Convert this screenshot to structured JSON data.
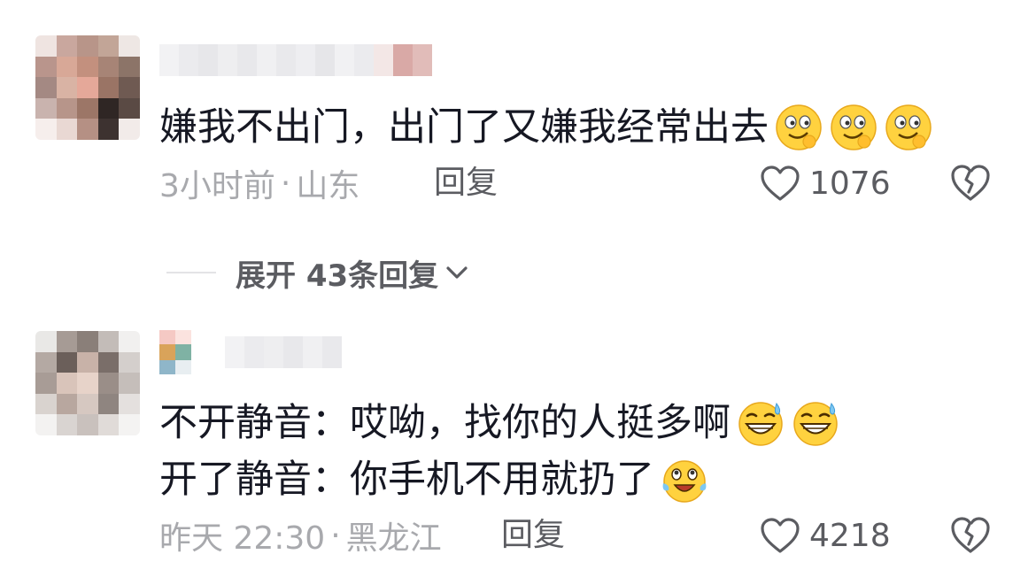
{
  "comments": [
    {
      "avatar_icon": "blurred-avatar",
      "username": "",
      "lines": [
        "嫌我不出门，出门了又嫌我经常出去"
      ],
      "emojis": [
        "smirk-emoji",
        "smirk-emoji",
        "smirk-emoji"
      ],
      "time": "3小时前",
      "separator": "·",
      "location": "山东",
      "reply_label": "回复",
      "like_icon": "heart-outline-icon",
      "like_count": "1076",
      "dislike_icon": "broken-heart-icon"
    },
    {
      "avatar_icon": "blurred-avatar",
      "username": "",
      "lines": [
        "不开静音：哎呦，找你的人挺多啊",
        "开了静音：你手机不用就扔了"
      ],
      "line1_emojis": [
        "sweat-grin-emoji",
        "sweat-grin-emoji"
      ],
      "line2_emojis": [
        "tears-of-joy-emoji"
      ],
      "time": "昨天 22:30",
      "separator": "·",
      "location": "黑龙江",
      "reply_label": "回复",
      "like_icon": "heart-outline-icon",
      "like_count": "4218",
      "dislike_icon": "broken-heart-icon"
    }
  ],
  "expand_replies": {
    "label": "展开 43条回复",
    "icon": "chevron-down-icon"
  },
  "colors": {
    "text_primary": "#161823",
    "text_secondary": "#a8a9ad",
    "text_action": "#5b5c61",
    "icon": "#5b5c61",
    "emoji_face": "#ffd23f"
  }
}
